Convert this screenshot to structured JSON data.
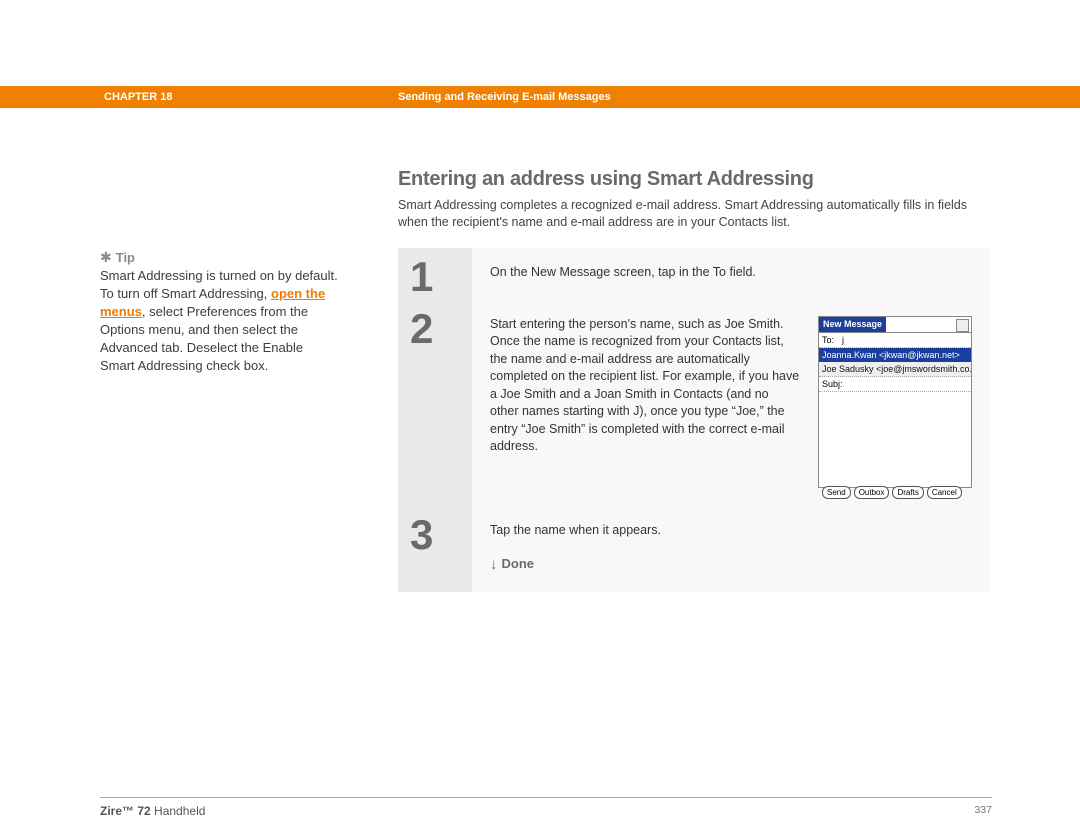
{
  "header": {
    "chapter": "CHAPTER 18",
    "title": "Sending and Receiving E-mail Messages"
  },
  "section": {
    "heading": "Entering an address using Smart Addressing",
    "intro": "Smart Addressing completes a recognized e-mail address. Smart Addressing automatically fills in fields when the recipient's name and e-mail address are in your Contacts list."
  },
  "tip": {
    "label": "Tip",
    "text_before_link": "Smart Addressing is turned on by default. To turn off Smart Addressing, ",
    "link": "open the menus",
    "text_after_link": ", select Preferences from the Options menu, and then select the Advanced tab. Deselect the Enable Smart Addressing check box."
  },
  "steps": [
    {
      "num": "1",
      "text": "On the New Message screen, tap in the To field."
    },
    {
      "num": "2",
      "text": "Start entering the person's name, such as Joe Smith.\nOnce the name is recognized from your Contacts list, the name and e-mail address are automatically completed on the recipient list. For example, if you have a Joe Smith and a Joan Smith in Contacts (and no other names starting with J), once you type “Joe,” the entry “Joe Smith” is completed with the correct e-mail address."
    },
    {
      "num": "3",
      "text": "Tap the name when it appears.",
      "done": "Done"
    }
  ],
  "device": {
    "title": "New Message",
    "to_label": "To:",
    "to_value": "j",
    "suggest1": "Joanna.Kwan <jkwan@jkwan.net>",
    "suggest2": "Joe Sadusky <joe@jmswordsmith.co...",
    "subj_label": "Subj:",
    "buttons": [
      "Send",
      "Outbox",
      "Drafts",
      "Cancel"
    ]
  },
  "footer": {
    "product_bold": "Zire™ 72",
    "product_rest": " Handheld",
    "page": "337"
  }
}
